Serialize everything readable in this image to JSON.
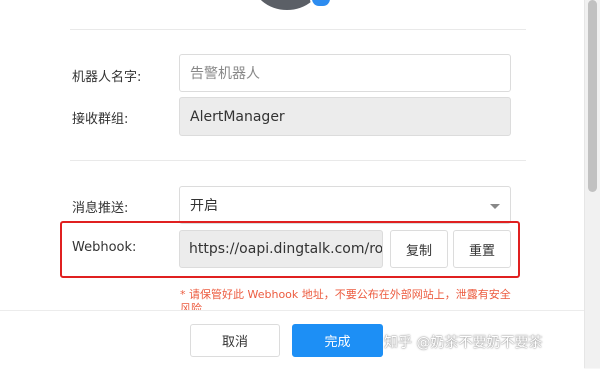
{
  "form": {
    "robot_name_label": "机器人名字:",
    "robot_name_placeholder": "告警机器人",
    "group_label": "接收群组:",
    "group_value": "AlertManager",
    "push_label": "消息推送:",
    "push_value": "开启",
    "webhook_label": "Webhook:",
    "webhook_value": "https://oapi.dingtalk.com/ro",
    "copy_label": "复制",
    "reset_label": "重置",
    "warning_text": "* 请保管好此 Webhook 地址，不要公布在外部网站上，泄露有安全风险"
  },
  "footer": {
    "cancel_label": "取消",
    "done_label": "完成"
  },
  "watermark": "知乎 @奶茶不要奶不要茶",
  "colors": {
    "primary": "#1d8ff5",
    "highlight_border": "#e02020",
    "warning": "#ec5b3f"
  }
}
